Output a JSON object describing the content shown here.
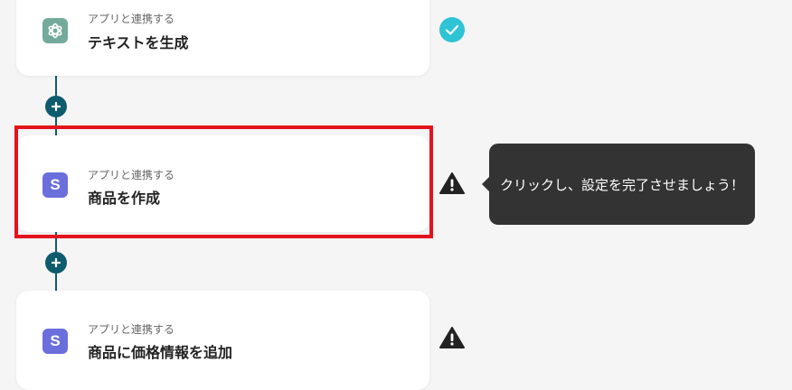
{
  "flow": {
    "steps": [
      {
        "subtitle": "アプリと連携する",
        "title": "テキストを生成",
        "app_icon": "openai-icon",
        "status": "check-circle-icon"
      },
      {
        "subtitle": "アプリと連携する",
        "title": "商品を作成",
        "app_icon": "stripe-icon",
        "app_icon_letter": "S",
        "status": "warning-icon"
      },
      {
        "subtitle": "アプリと連携する",
        "title": "商品に価格情報を追加",
        "app_icon": "stripe-icon",
        "app_icon_letter": "S",
        "status": "warning-icon"
      }
    ],
    "add_button_icon": "plus-icon"
  },
  "tooltip": {
    "text": "クリックし、設定を完了させましょう！"
  },
  "colors": {
    "connector": "#0f5b6e",
    "check": "#2ec4d6",
    "warning": "#222222",
    "highlight": "#e3141c",
    "stripe": "#6a6fdc",
    "openai": "#74aa9c",
    "tooltip_bg": "#333333"
  }
}
